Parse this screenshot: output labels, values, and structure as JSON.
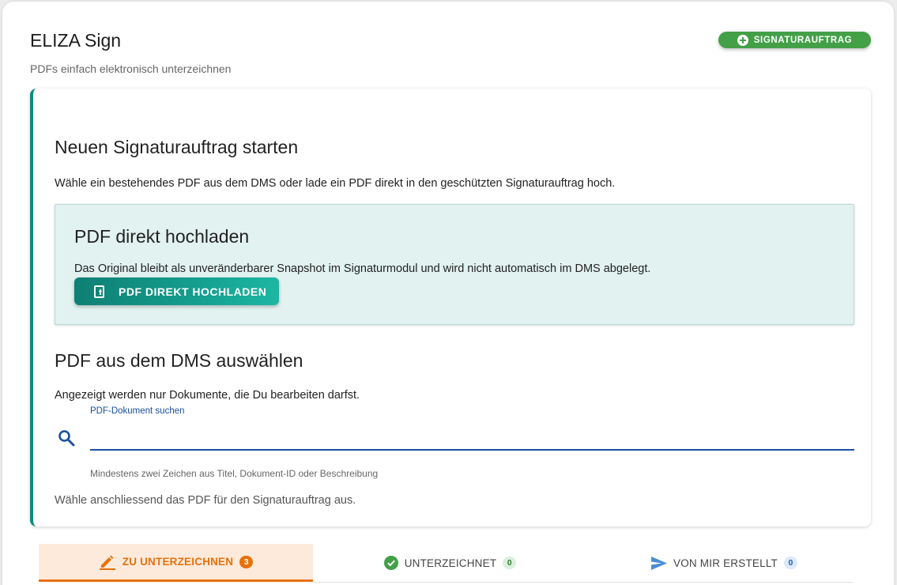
{
  "header": {
    "title": "ELIZA Sign",
    "subtitle": "PDFs einfach elektronisch unterzeichnen",
    "new_button_label": "SIGNATURAUFTRAG"
  },
  "card": {
    "title": "Neuen Signaturauftrag starten",
    "description": "Wähle ein bestehendes PDF aus dem DMS oder lade ein PDF direkt in den geschützten Signaturauftrag hoch.",
    "upload": {
      "title": "PDF direkt hochladen",
      "description": "Das Original bleibt als unveränderbarer Snapshot im Signaturmodul und wird nicht automatisch im DMS abgelegt.",
      "button_label": "PDF DIREKT HOCHLADEN"
    },
    "dms": {
      "title": "PDF aus dem DMS auswählen",
      "description": "Angezeigt werden nur Dokumente, die Du bearbeiten darfst.",
      "search_label": "PDF-Dokument suchen",
      "search_value": "",
      "search_hint": "Mindestens zwei Zeichen aus Titel, Dokument-ID oder Beschreibung"
    },
    "footer": "Wähle anschliessend das PDF für den Signaturauftrag aus."
  },
  "tabs": [
    {
      "label": "ZU UNTERZEICHNEN",
      "count": "3",
      "icon": "pen-icon",
      "active": true
    },
    {
      "label": "UNTERZEICHNET",
      "count": "0",
      "icon": "check-circle-icon",
      "active": false
    },
    {
      "label": "VON MIR ERSTELLT",
      "count": "0",
      "icon": "send-icon",
      "active": false
    }
  ],
  "colors": {
    "accent_teal": "#0f8a7d",
    "new_button_green": "#43a047",
    "active_tab_orange": "#e8710a",
    "search_blue": "#1a4fa0"
  }
}
